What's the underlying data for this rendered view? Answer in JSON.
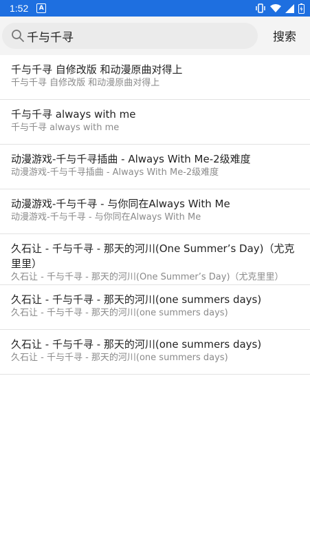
{
  "status_bar": {
    "time": "1:52",
    "app_icon_letter": "A",
    "icons": [
      "vibrate-icon",
      "wifi-icon",
      "signal-icon",
      "battery-icon"
    ]
  },
  "search": {
    "query": "千与千寻",
    "button_label": "搜索"
  },
  "results": [
    {
      "title": "千与千寻 自修改版 和动漫原曲对得上",
      "subtitle": "千与千寻 自修改版 和动漫原曲对得上"
    },
    {
      "title": "千与千寻 always with me",
      "subtitle": "千与千寻 always with me"
    },
    {
      "title": "动漫游戏-千与千寻插曲 - Always With Me-2级难度",
      "subtitle": "动漫游戏-千与千寻插曲 - Always With Me-2级难度"
    },
    {
      "title": "动漫游戏-千与千寻 - 与你同在Always With Me",
      "subtitle": "动漫游戏-千与千寻 - 与你同在Always With Me"
    },
    {
      "title": "久石让 - 千与千寻 - 那天的河川(One Summer’s Day)（尤克里里）",
      "subtitle": "久石让 - 千与千寻 - 那天的河川(One Summer’s Day)（尤克里里）"
    },
    {
      "title": "久石让 - 千与千寻 - 那天的河川(one summers days)",
      "subtitle": "久石让 - 千与千寻 - 那天的河川(one summers days)"
    },
    {
      "title": "久石让 - 千与千寻 - 那天的河川(one summers days)",
      "subtitle": "久石让 - 千与千寻 - 那天的河川(one summers days)"
    }
  ],
  "colors": {
    "status_bar": "#1e6fe0",
    "search_bar_bg": "#f4f4f4",
    "search_field_bg": "#ebebeb",
    "divider": "#e2e2e2",
    "subtitle_text": "#8a8a8a"
  }
}
